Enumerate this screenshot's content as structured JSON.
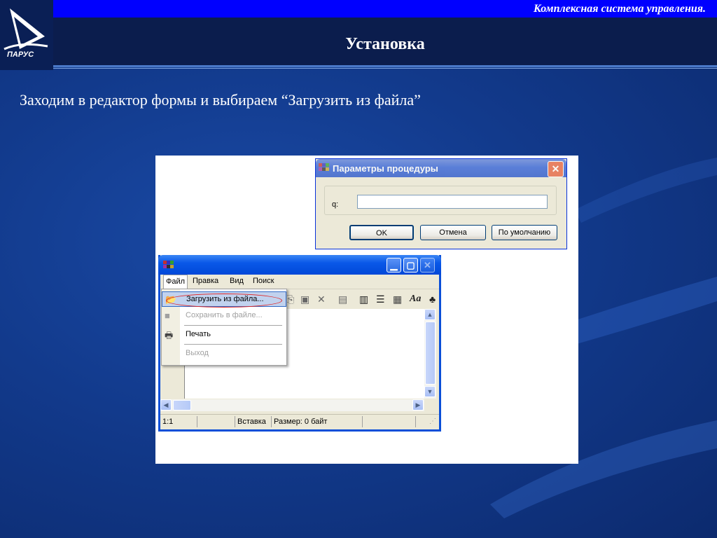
{
  "header": {
    "company": "Комплексная система управления.",
    "title": "Установка",
    "logo_text": "ПАРУС"
  },
  "intro": "Заходим в редактор формы и выбираем “Загрузить из файла”",
  "dialog": {
    "title": "Параметры процедуры",
    "param_label": "q:",
    "param_value": "",
    "buttons": {
      "ok": "OK",
      "cancel": "Отмена",
      "default": "По умолчанию"
    }
  },
  "editor": {
    "menu": [
      "Файл",
      "Правка",
      "Вид",
      "Поиск"
    ],
    "file_menu": {
      "load": "Загрузить из файла...",
      "save": "Сохранить в файле...",
      "print": "Печать",
      "exit": "Выход"
    },
    "status": {
      "position": "1:1",
      "mode": "Вставка",
      "size": "Размер: 0 байт"
    }
  },
  "colors": {
    "topbar": "#0000ff",
    "header_dark": "#0b1d4d",
    "background": "#123a8c",
    "highlight_ring": "#e02020"
  }
}
